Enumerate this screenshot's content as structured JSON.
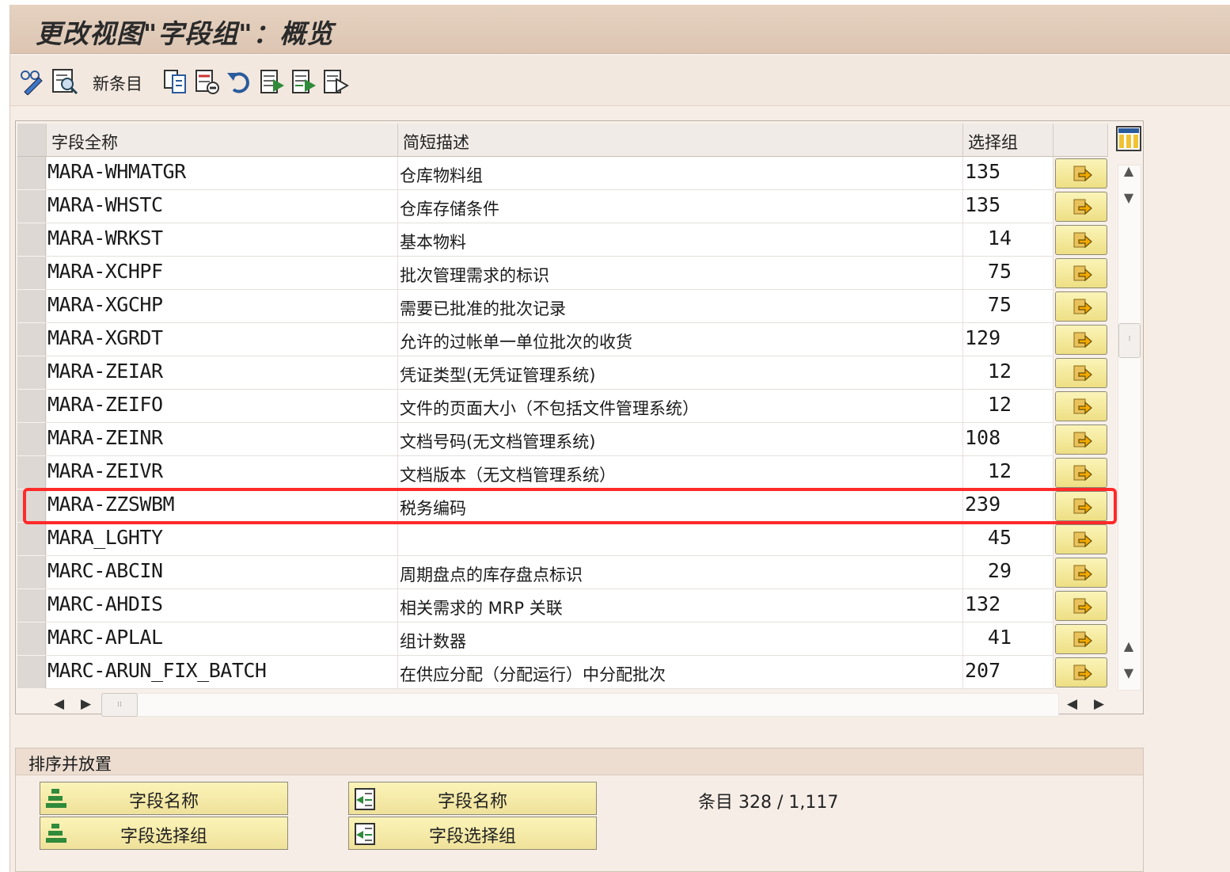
{
  "window": {
    "title": "更改视图\"字段组\"：概览"
  },
  "toolbar": {
    "new_entries_label": "新条目",
    "icons": [
      "display-change-icon",
      "detail-icon",
      "copy-icon",
      "delete-icon",
      "undo-icon",
      "select-all-icon",
      "select-block-icon",
      "deselect-all-icon"
    ]
  },
  "table": {
    "columns": [
      "字段全称",
      "简短描述",
      "选择组"
    ],
    "rows": [
      {
        "name": "MARA-WHMATGR",
        "desc": "仓库物料组",
        "group": "135"
      },
      {
        "name": "MARA-WHSTC",
        "desc": "仓库存储条件",
        "group": "135"
      },
      {
        "name": "MARA-WRKST",
        "desc": "基本物料",
        "group": "14"
      },
      {
        "name": "MARA-XCHPF",
        "desc": "批次管理需求的标识",
        "group": "75"
      },
      {
        "name": "MARA-XGCHP",
        "desc": "需要已批准的批次记录",
        "group": "75"
      },
      {
        "name": "MARA-XGRDT",
        "desc": "允许的过帐单一单位批次的收货",
        "group": "129"
      },
      {
        "name": "MARA-ZEIAR",
        "desc": "凭证类型(无凭证管理系统)",
        "group": "12"
      },
      {
        "name": "MARA-ZEIFO",
        "desc": "文件的页面大小（不包括文件管理系统）",
        "group": "12"
      },
      {
        "name": "MARA-ZEINR",
        "desc": "文档号码(无文档管理系统)",
        "group": "108"
      },
      {
        "name": "MARA-ZEIVR",
        "desc": "文档版本（无文档管理系统）",
        "group": "12"
      },
      {
        "name": "MARA-ZZSWBM",
        "desc": "税务编码",
        "group": "239",
        "highlighted": true
      },
      {
        "name": "MARA_LGHTY",
        "desc": "",
        "group": "45"
      },
      {
        "name": "MARC-ABCIN",
        "desc": "周期盘点的库存盘点标识",
        "group": "29"
      },
      {
        "name": "MARC-AHDIS",
        "desc": "相关需求的 MRP  关联",
        "group": "132"
      },
      {
        "name": "MARC-APLAL",
        "desc": "组计数器",
        "group": "41"
      },
      {
        "name": "MARC-ARUN_FIX_BATCH",
        "desc": "在供应分配（分配运行）中分配批次",
        "group": "207"
      }
    ]
  },
  "sort": {
    "title": "排序并放置",
    "sort_field_name": "字段名称",
    "sort_field_group": "字段选择组",
    "position_field_name": "字段名称",
    "position_field_group": "字段选择组",
    "entry_count": "条目 328 / 1,117"
  },
  "colors": {
    "highlight": "#ff2a2a",
    "button_yellow": "#f4e796",
    "title_bg": "#e0cab7"
  }
}
